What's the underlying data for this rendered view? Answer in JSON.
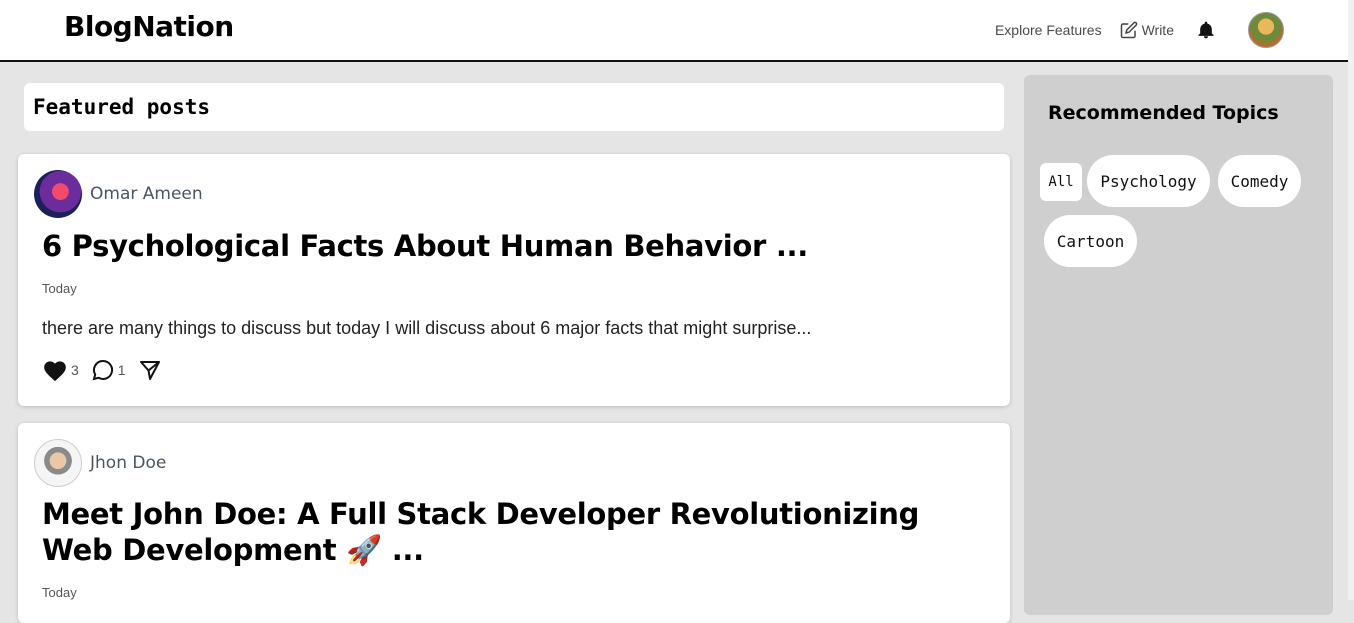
{
  "header": {
    "logo": "BlogNation",
    "explore_label": "Explore Features",
    "write_label": "Write"
  },
  "featured": {
    "heading": "Featured posts"
  },
  "posts": [
    {
      "author": "Omar Ameen",
      "title": "6 Psychological Facts About Human Behavior ...",
      "date": "Today",
      "excerpt": "there are many things to discuss but today I will discuss about 6 major facts that might surprise...",
      "likes": "3",
      "comments": "1"
    },
    {
      "author": "Jhon Doe",
      "title": "Meet John Doe: A Full Stack Developer Revolutionizing Web Development 🚀 ...",
      "date": "Today"
    }
  ],
  "sidebar": {
    "title": "Recommended Topics",
    "topics": [
      "All",
      "Psychology",
      "Comedy",
      "Cartoon"
    ]
  },
  "icons": {
    "write": "edit-icon",
    "notifications": "bell-icon",
    "like": "heart-icon",
    "comment": "comment-icon",
    "share": "send-icon"
  }
}
